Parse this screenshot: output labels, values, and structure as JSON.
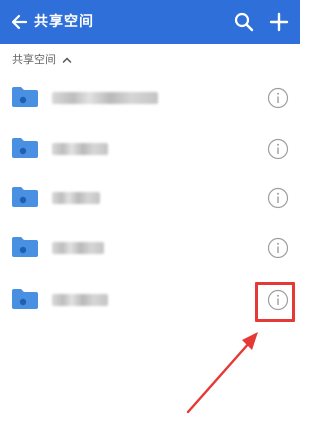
{
  "appbar": {
    "title": "共享空间",
    "back_icon": "arrow-left-icon",
    "search_icon": "search-icon",
    "add_icon": "plus-icon",
    "color": "#2f6fd9"
  },
  "section": {
    "label": "共享空间",
    "toggle_icon": "chevron-up-icon"
  },
  "folders": [
    {
      "name_redacted": true,
      "icon": "shared-folder-icon",
      "info_icon": "info-icon"
    },
    {
      "name_redacted": true,
      "icon": "shared-folder-icon",
      "info_icon": "info-icon"
    },
    {
      "name_redacted": true,
      "icon": "shared-folder-icon",
      "info_icon": "info-icon"
    },
    {
      "name_redacted": true,
      "icon": "shared-folder-icon",
      "info_icon": "info-icon"
    },
    {
      "name_redacted": true,
      "icon": "shared-folder-icon",
      "info_icon": "info-icon",
      "highlighted": true
    }
  ],
  "annotation": {
    "highlight_color": "#e53935"
  }
}
